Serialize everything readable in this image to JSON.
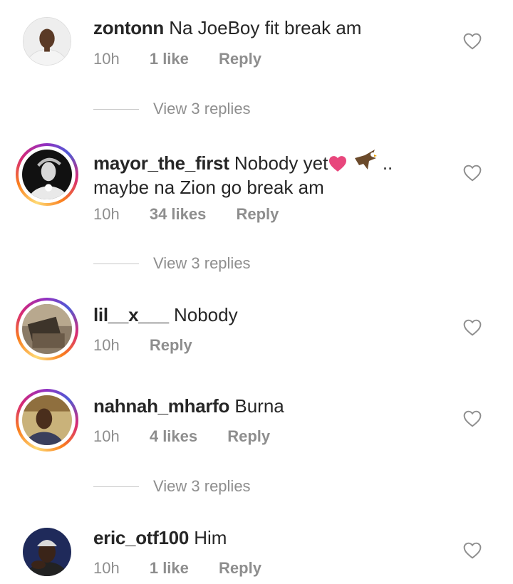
{
  "comments": [
    {
      "username": "zontonn",
      "text": "Na JoeBoy fit break am",
      "time": "10h",
      "likes": "1 like",
      "reply_label": "Reply",
      "view_replies": "View 3 replies"
    },
    {
      "username": "mayor_the_first",
      "text_line1": "Nobody yet",
      "text_dots": "..",
      "text_line2": "maybe na Zion go break am",
      "time": "10h",
      "likes": "34 likes",
      "reply_label": "Reply",
      "view_replies": "View 3 replies"
    },
    {
      "username": "lil__x___",
      "text": "Nobody",
      "time": "10h",
      "reply_label": "Reply"
    },
    {
      "username": "nahnah_mharfo",
      "text": "Burna",
      "time": "10h",
      "likes": "4 likes",
      "reply_label": "Reply",
      "view_replies": "View 3 replies"
    },
    {
      "username": "eric_otf100",
      "text": "Him",
      "time": "10h",
      "likes": "1 like",
      "reply_label": "Reply"
    }
  ],
  "colors": {
    "text": "#262626",
    "muted": "#8e8e8e",
    "heart_emoji": "#e8467c"
  },
  "icons": {
    "like": "heart-outline-icon",
    "emoji1": "pink-heart-emoji",
    "emoji2": "eagle-emoji"
  }
}
